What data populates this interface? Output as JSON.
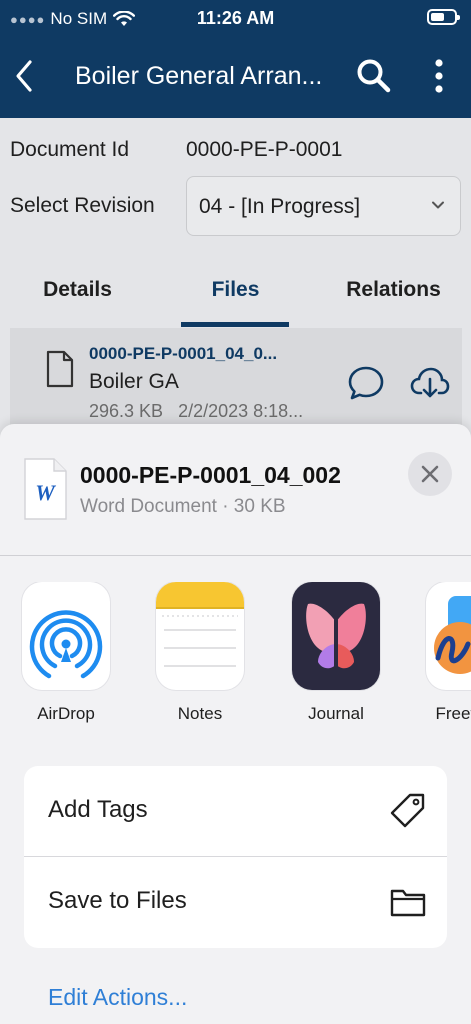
{
  "status_bar": {
    "carrier": "No SIM",
    "time": "11:26 AM"
  },
  "nav": {
    "title": "Boiler General Arran..."
  },
  "document": {
    "id_label": "Document Id",
    "id_value": "0000-PE-P-0001",
    "revision_label": "Select Revision",
    "revision_value": "04 - [In Progress]"
  },
  "tabs": [
    {
      "label": "Details",
      "active": false
    },
    {
      "label": "Files",
      "active": true
    },
    {
      "label": "Relations",
      "active": false
    }
  ],
  "file": {
    "name": "0000-PE-P-0001_04_0...",
    "description": "Boiler GA",
    "size": "296.3 KB",
    "date": "2/2/2023 8:18..."
  },
  "share_sheet": {
    "title": "0000-PE-P-0001_04_002",
    "subtitle": "Word Document · 30 KB",
    "apps": [
      {
        "name": "AirDrop",
        "icon": "airdrop-icon"
      },
      {
        "name": "Notes",
        "icon": "notes-icon"
      },
      {
        "name": "Journal",
        "icon": "journal-icon"
      },
      {
        "name": "Freeform",
        "icon": "freeform-icon"
      }
    ],
    "actions": [
      {
        "label": "Add Tags",
        "icon": "tag-icon"
      },
      {
        "label": "Save to Files",
        "icon": "folder-icon"
      }
    ],
    "edit_actions": "Edit Actions..."
  },
  "colors": {
    "nav_background": "#0f3a63",
    "accent": "#0f3a63",
    "link_blue": "#2f7fd6",
    "word_blue": "#1d5fc0"
  }
}
